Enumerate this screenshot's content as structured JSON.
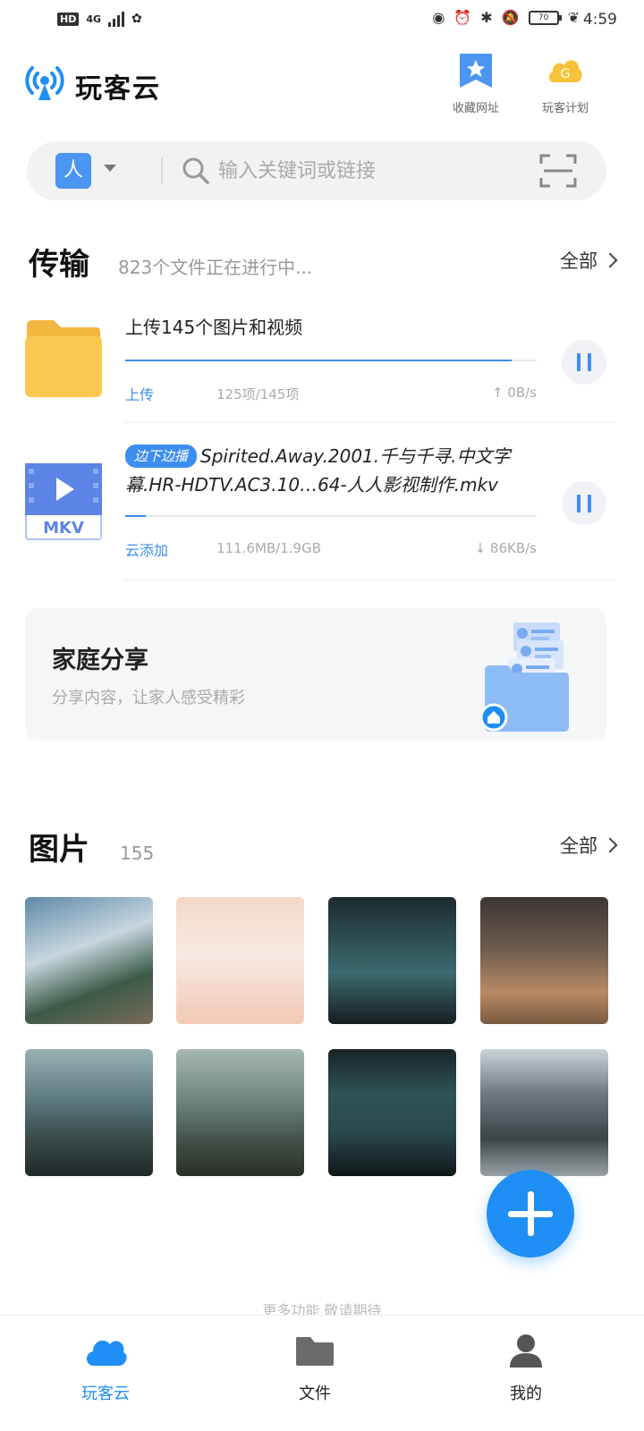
{
  "status_bar": {
    "hd": "HD",
    "network": "4G",
    "battery": "70",
    "time": "4:59"
  },
  "header": {
    "title": "玩客云",
    "favorites_label": "收藏网址",
    "plan_label": "玩客计划"
  },
  "search": {
    "account_initial": "人",
    "placeholder": "输入关键词或链接"
  },
  "transfer": {
    "title": "传输",
    "subtitle": "823个文件正在进行中...",
    "all_label": "全部",
    "items": [
      {
        "name": "上传145个图片和视频",
        "type_label": "上传",
        "size": "125项/145项",
        "speed": "0B/s",
        "progress": 0.94
      },
      {
        "tag": "边下边播",
        "name": "Spirited.Away.2001.千与千寻.中文字幕.HR-HDTV.AC3.10…64-人人影视制作.mkv",
        "type_label": "云添加",
        "size": "111.6MB/1.9GB",
        "speed": "86KB/s",
        "progress": 0.05,
        "thumb_label": "MKV"
      }
    ]
  },
  "family_share": {
    "title": "家庭分享",
    "subtitle": "分享内容，让家人感受精彩"
  },
  "pictures": {
    "title": "图片",
    "count": "155",
    "all_label": "全部"
  },
  "more_text": "更多功能 敬请期待",
  "bottom_nav": {
    "items": [
      {
        "label": "玩客云"
      },
      {
        "label": "文件"
      },
      {
        "label": "我的"
      }
    ]
  },
  "colors": {
    "accent": "#1f8ef5",
    "progress": "#3d8ef0"
  }
}
